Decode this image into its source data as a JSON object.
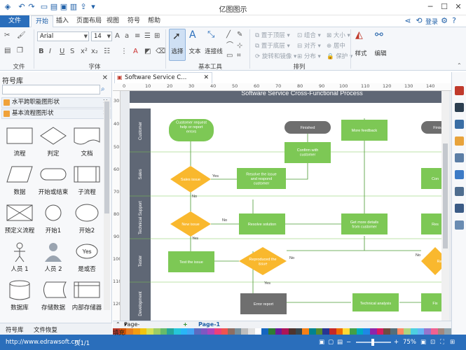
{
  "app": {
    "title": "亿图图示"
  },
  "ribbon_tabs": [
    "文件",
    "开始",
    "插入",
    "页面布局",
    "视图",
    "符号",
    "帮助"
  ],
  "account": {
    "login": "登录"
  },
  "ribbon": {
    "font_name": "Arial",
    "font_size": "14",
    "groups": {
      "file": "文件",
      "font": "字体",
      "basic_tools": "基本工具",
      "arrange": "排列"
    },
    "tools": {
      "select": "选择",
      "text": "文本",
      "connector": "连接线"
    },
    "arrange": {
      "bring_front": "置于顶层",
      "send_back": "置于底层",
      "rotate_mirror": "旋转和镜像",
      "group": "组合",
      "align": "对齐",
      "distribute": "分布",
      "size": "大小",
      "center": "居中",
      "protect": "保护"
    },
    "style": "样式",
    "edit": "编辑"
  },
  "library": {
    "title": "符号库",
    "categories": [
      "水平跨职能图形状",
      "基本流程图形状"
    ],
    "shapes": [
      {
        "label": "流程",
        "icon": "process-shape"
      },
      {
        "label": "判定",
        "icon": "decision-shape"
      },
      {
        "label": "文档",
        "icon": "document-shape"
      },
      {
        "label": "数据",
        "icon": "data-shape"
      },
      {
        "label": "开始或结束",
        "icon": "terminator-shape"
      },
      {
        "label": "子流程",
        "icon": "subprocess-shape"
      },
      {
        "label": "预定义流程",
        "icon": "predefined-process-shape"
      },
      {
        "label": "开始1",
        "icon": "start1-shape"
      },
      {
        "label": "开始2",
        "icon": "start2-shape"
      },
      {
        "label": "人员 1",
        "icon": "person1-shape"
      },
      {
        "label": "人员 2",
        "icon": "person2-shape"
      },
      {
        "label": "是或否",
        "icon": "yes-no-shape",
        "inner": "Yes"
      },
      {
        "label": "数据库",
        "icon": "database-shape"
      },
      {
        "label": "存储数据",
        "icon": "stored-data-shape"
      },
      {
        "label": "内部存储器",
        "icon": "internal-storage-shape"
      }
    ],
    "bottom_tabs": [
      "符号库",
      "文件恢复"
    ]
  },
  "document": {
    "tab": "Software Service C..."
  },
  "diagram": {
    "title": "Software Service Cross-Functional Process",
    "lanes": [
      "Customer",
      "Sales",
      "Technical Support",
      "Tester",
      "Development"
    ],
    "nodes": {
      "customer_request": "Customer request help or report errors",
      "finished": "Finished",
      "more_feedback": "More feedback",
      "finished2": "Finis",
      "confirm": "Confirm with customer",
      "sales_issue": "Sales issue",
      "resolve_issue": "Resolve the issue and respond customer",
      "confirm2": "Con",
      "new_issue": "New issue",
      "resolve_solution": "Resolve solution",
      "get_more": "Get more details from customer",
      "resolve2": "Res",
      "test_issue": "Test the issue",
      "reproduced": "Reproduced the issue",
      "repro2": "Re",
      "error_report": "Error report",
      "tech_analysis": "Technical analysis",
      "fix": "Fix"
    },
    "edge_labels": {
      "yes": "Yes",
      "no": "No"
    }
  },
  "page_tabs": {
    "current": "Page-1",
    "active": "Page-1"
  },
  "status": {
    "url": "http://www.edrawsoft.cn/",
    "page": "页1/1",
    "zoom": "75%"
  },
  "status_labels": {
    "fill": "填充"
  },
  "colors": {
    "accent": "#2a6ebb",
    "lane_header": "#5f6775",
    "process": "#7dc855",
    "decision": "#f9b82e",
    "terminator": "#6e6e6e",
    "error": "#6f6f6f"
  }
}
